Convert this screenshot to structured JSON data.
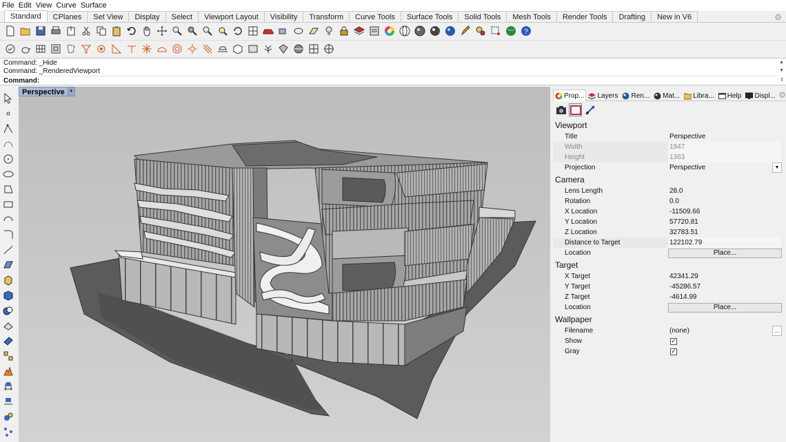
{
  "menus": [
    "File",
    "Edit",
    "View",
    "Curve",
    "Surface"
  ],
  "tabs": [
    "Standard",
    "CPlanes",
    "Set View",
    "Display",
    "Select",
    "Viewport Layout",
    "Visibility",
    "Transform",
    "Curve Tools",
    "Surface Tools",
    "Solid Tools",
    "Mesh Tools",
    "Render Tools",
    "Drafting",
    "New in V6"
  ],
  "command": {
    "history1": "Command: _Hide",
    "history2": "Command: _RenderedViewport",
    "prompt": "Command:",
    "input": ""
  },
  "viewport": {
    "label": "Perspective"
  },
  "panel": {
    "tabs": [
      "Prop...",
      "Layers",
      "Ren...",
      "Mat...",
      "Libra...",
      "Help",
      "Displ..."
    ],
    "sections": {
      "viewport": "Viewport",
      "camera": "Camera",
      "target": "Target",
      "wallpaper": "Wallpaper"
    },
    "viewport_rows": {
      "title_label": "Title",
      "title_value": "Perspective",
      "width_label": "Width",
      "width_value": "1947",
      "height_label": "Height",
      "height_value": "1363",
      "projection_label": "Projection",
      "projection_value": "Perspective"
    },
    "camera_rows": {
      "lens_label": "Lens Length",
      "lens_value": "28.0",
      "rotation_label": "Rotation",
      "rotation_value": "0.0",
      "xloc_label": "X Location",
      "xloc_value": "-11509.66",
      "yloc_label": "Y Location",
      "yloc_value": "57720.81",
      "zloc_label": "Z Location",
      "zloc_value": "32783.51",
      "dist_label": "Distance to Target",
      "dist_value": "122102.79",
      "location_label": "Location",
      "place_button": "Place..."
    },
    "target_rows": {
      "xt_label": "X Target",
      "xt_value": "42341.29",
      "yt_label": "Y Target",
      "yt_value": "-45286.57",
      "zt_label": "Z Target",
      "zt_value": "-4614.99",
      "location_label": "Location",
      "place_button": "Place..."
    },
    "wallpaper_rows": {
      "filename_label": "Filename",
      "filename_value": "(none)",
      "browse": "...",
      "show_label": "Show",
      "show_checked": true,
      "gray_label": "Gray",
      "gray_checked": true,
      "check_glyph": "✓"
    }
  }
}
